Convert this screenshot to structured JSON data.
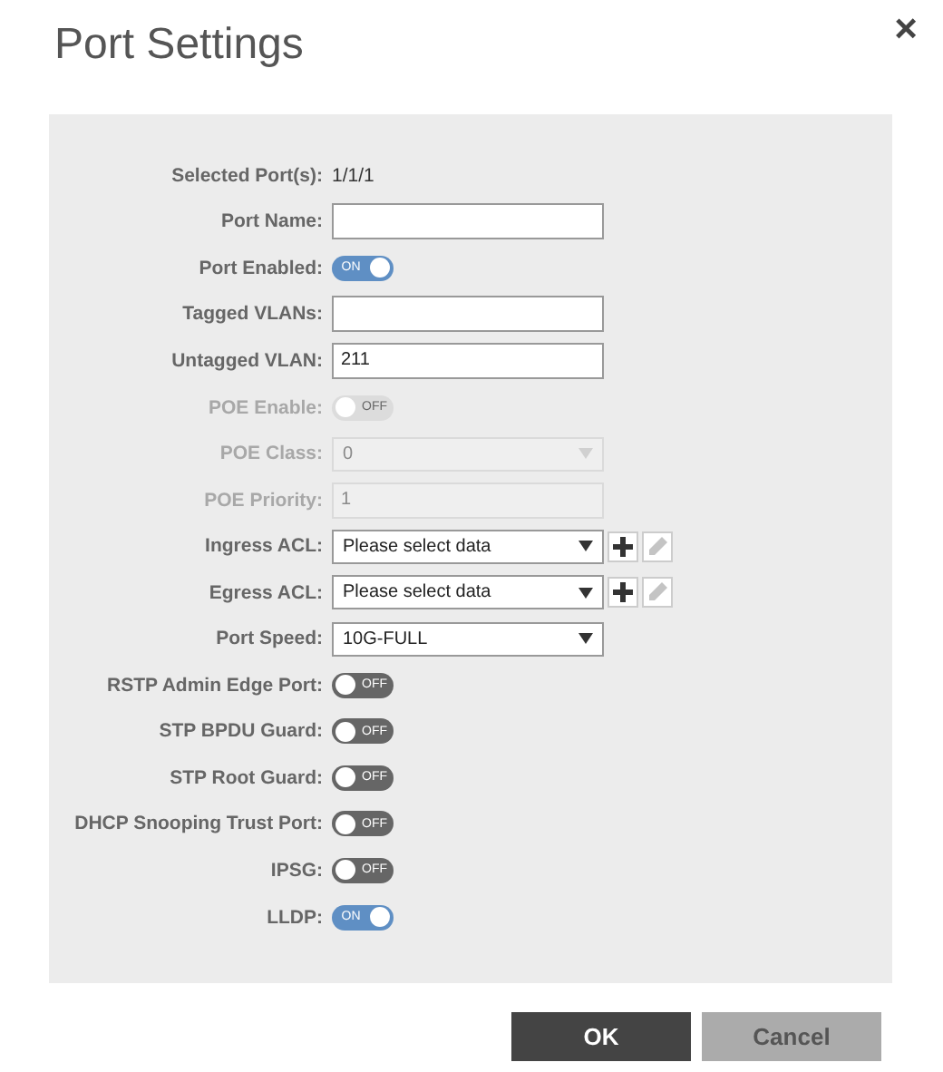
{
  "dialog": {
    "title": "Port Settings",
    "close": "×"
  },
  "fields": [
    {
      "kind": "text",
      "label": "Selected Port(s):",
      "value": "1/1/1"
    },
    {
      "kind": "input",
      "label": "Port Name:",
      "disabled": false
    },
    {
      "kind": "toggle",
      "label": "Port Enabled:",
      "on": true,
      "text": "ON",
      "disabled": false
    },
    {
      "kind": "input",
      "label": "Tagged VLANs:",
      "disabled": false
    },
    {
      "kind": "input",
      "label": "Untagged VLAN:",
      "value": "211",
      "disabled": false
    },
    {
      "kind": "toggle",
      "label": "POE Enable:",
      "on": false,
      "text": "OFF",
      "disabled": true
    },
    {
      "kind": "select",
      "label": "POE Class:",
      "value": "0",
      "disabled": true
    },
    {
      "kind": "input",
      "label": "POE Priority:",
      "value": "1",
      "disabled": true
    },
    {
      "kind": "acl",
      "label": "Ingress ACL:",
      "value": "Please select data",
      "disabled": false
    },
    {
      "kind": "acl",
      "label": "Egress ACL:",
      "value": "Please select data",
      "disabled": false
    },
    {
      "kind": "select",
      "label": "Port Speed:",
      "value": "10G-FULL",
      "disabled": false
    },
    {
      "kind": "toggle",
      "label": "RSTP Admin Edge Port:",
      "on": false,
      "text": "OFF",
      "disabled": false
    },
    {
      "kind": "toggle",
      "label": "STP BPDU Guard:",
      "on": false,
      "text": "OFF",
      "disabled": false
    },
    {
      "kind": "toggle",
      "label": "STP Root Guard:",
      "on": false,
      "text": "OFF",
      "disabled": false
    },
    {
      "kind": "toggle",
      "label": "DHCP Snooping Trust Port:",
      "on": false,
      "text": "OFF",
      "disabled": false
    },
    {
      "kind": "toggle",
      "label": "IPSG:",
      "on": false,
      "text": "OFF",
      "disabled": false
    },
    {
      "kind": "toggle",
      "label": "LLDP:",
      "on": true,
      "text": "ON",
      "disabled": false
    }
  ],
  "buttons": [
    {
      "kind": "primary",
      "label": "OK"
    },
    {
      "kind": "secondary",
      "label": "Cancel"
    }
  ]
}
